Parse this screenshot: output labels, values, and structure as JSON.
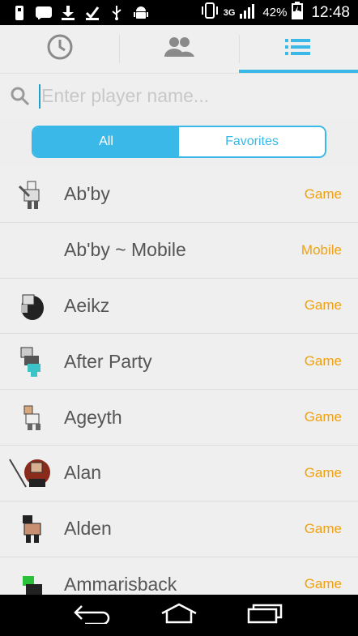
{
  "status_bar": {
    "network": "3G",
    "battery_pct": "42%",
    "time": "12:48",
    "icons": [
      "usb-drive-icon",
      "chat-icon",
      "download-icon",
      "checkmark-icon",
      "usb-icon",
      "android-icon"
    ]
  },
  "tabs": [
    {
      "name": "clock-icon",
      "active": false
    },
    {
      "name": "people-icon",
      "active": false
    },
    {
      "name": "list-icon",
      "active": true
    }
  ],
  "search": {
    "placeholder": "Enter player name...",
    "value": ""
  },
  "filter": {
    "all_label": "All",
    "favorites_label": "Favorites",
    "selected": "All"
  },
  "players": [
    {
      "name": "Ab'by",
      "type": "Game",
      "avatar": "avatar-abby"
    },
    {
      "name": "Ab'by ~ Mobile",
      "type": "Mobile",
      "avatar": ""
    },
    {
      "name": "Aeikz",
      "type": "Game",
      "avatar": "avatar-aeikz"
    },
    {
      "name": "After Party",
      "type": "Game",
      "avatar": "avatar-after-party"
    },
    {
      "name": "Ageyth",
      "type": "Game",
      "avatar": "avatar-ageyth"
    },
    {
      "name": "Alan",
      "type": "Game",
      "avatar": "avatar-alan"
    },
    {
      "name": "Alden",
      "type": "Game",
      "avatar": "avatar-alden"
    },
    {
      "name": "Ammarisback",
      "type": "Game",
      "avatar": "avatar-ammarisback"
    }
  ],
  "colors": {
    "accent": "#3ab8e8",
    "type_label": "#f0a010"
  }
}
